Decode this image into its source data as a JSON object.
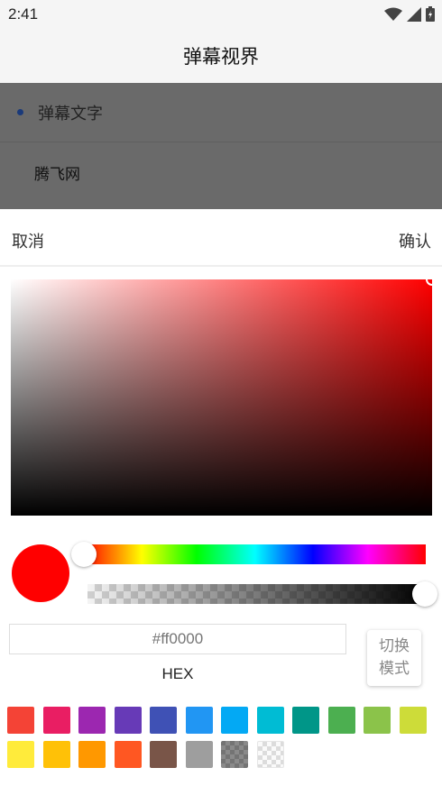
{
  "status_bar": {
    "time": "2:41",
    "icons": [
      "wifi-icon",
      "signal-icon",
      "battery-icon"
    ]
  },
  "app_bar": {
    "title": "弹幕视界"
  },
  "background_list": {
    "items": [
      {
        "label": "弹幕文字",
        "selected": true
      },
      {
        "label": "腾飞网",
        "selected": false
      }
    ]
  },
  "dialog": {
    "cancel_label": "取消",
    "confirm_label": "确认",
    "current_color": "#ff0000",
    "hue_fraction": 0.0,
    "alpha_fraction": 1.0,
    "hex": {
      "placeholder": "#ff0000",
      "value": "",
      "label": "HEX"
    },
    "mode_button_label": "切换\n模式",
    "swatches": [
      [
        "#f44336",
        "#e91e63",
        "#9c27b0",
        "#673ab7",
        "#3f51b5",
        "#2196f3",
        "#03a9f4",
        "#00bcd4",
        "#009688",
        "#4caf50",
        "#8bc34a",
        "#cddc39"
      ],
      [
        "#ffeb3b",
        "#ffc107",
        "#ff9800",
        "#ff5722",
        "#795548",
        "#9e9e9e",
        "checker-grey",
        "transparent"
      ]
    ]
  }
}
